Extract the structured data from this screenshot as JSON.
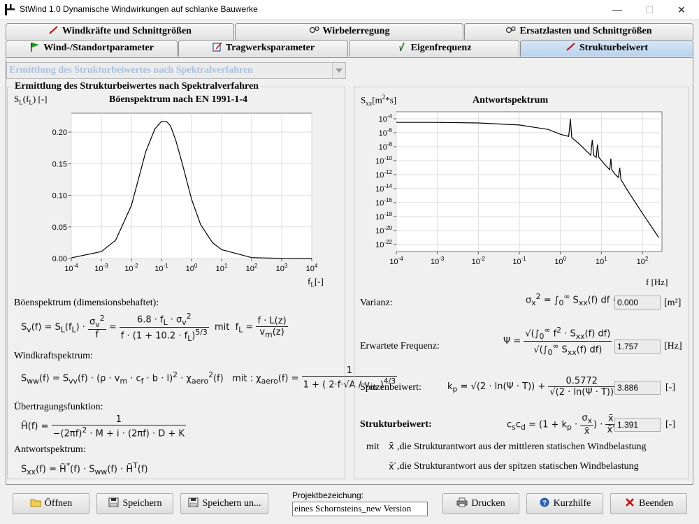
{
  "window": {
    "title": "StWind 1.0    Dynamische Windwirkungen auf schlanke Bauwerke",
    "minimize": "—",
    "maximize": "☐",
    "close": "✕"
  },
  "tabs_row1": [
    {
      "label": "Windkräfte und Schnittgrößen",
      "icon": "pen-icon"
    },
    {
      "label": "Wirbelerregung",
      "icon": "vortex-icon"
    },
    {
      "label": "Ersatzlasten und Schnittgrößen",
      "icon": "vortex-icon"
    }
  ],
  "tabs_row2": [
    {
      "label": "Wind-/Standortparameter",
      "icon": "flag-icon"
    },
    {
      "label": "Tragwerksparameter",
      "icon": "notepad-icon"
    },
    {
      "label": "Eigenfrequenz",
      "icon": "pencil-icon"
    },
    {
      "label": "Strukturbeiwert",
      "icon": "pen-icon",
      "active": true
    }
  ],
  "method_select": {
    "value": "Ermittlung des Strukturbeiwertes nach Spektralverfahren"
  },
  "left_group": {
    "title": "Ermittlung des Strukturbeiwertes nach Spektralverfahren",
    "chart_ylabel": "S_L(f_L) [-]",
    "chart_title": "Böenspektrum nach EN 1991-1-4",
    "chart_xlabel": "f_L [-]",
    "boen_label": "Böenspektrum (dimensionsbehaftet):",
    "windkraft_label": "Windkraftspektrum:",
    "uebertragung_label": "Übertragungsfunktion:",
    "antwort_label": "Antwortspektrum:"
  },
  "right_group": {
    "chart_ylabel": "S_xx [m²*s]",
    "chart_title": "Antwortspektrum",
    "chart_xlabel": "f [Hz]",
    "varianz_label": "Varianz:",
    "varianz_value": "0.000",
    "varianz_unit": "[m²]",
    "frequenz_label": "Erwartete Frequenz:",
    "frequenz_value": "1.757",
    "frequenz_unit": "[Hz]",
    "spitzen_label": "Spitzenbeiwert:",
    "spitzen_value": "3.886",
    "spitzen_unit": "[-]",
    "struktur_label": "Strukturbeiwert:",
    "struktur_value": "1.391",
    "struktur_unit": "[-]",
    "mit": "mit",
    "note1": ",die Strukturantwort aus der mittleren statischen Windbelastung",
    "note2": ",die Strukturantwort aus der spitzen statischen Windbelastung"
  },
  "buttons": {
    "open": "Öffnen",
    "save": "Speichern",
    "save_as": "Speichern un...",
    "print": "Drucken",
    "help": "Kurzhilfe",
    "exit": "Beenden"
  },
  "project": {
    "label": "Projektbezeichung:",
    "value": "eines Schornsteins_new Version"
  },
  "chart_data": [
    {
      "type": "line",
      "title": "Böenspektrum nach EN 1991-1-4",
      "xlabel": "f_L [-]",
      "ylabel": "S_L(f_L) [-]",
      "xscale": "log",
      "xlim": [
        0.0001,
        10000
      ],
      "ylim": [
        0,
        0.23
      ],
      "xticks": [
        "10-4",
        "10-3",
        "10-2",
        "10-1",
        "100",
        "101",
        "102",
        "103",
        "104"
      ],
      "yticks": [
        "0.00",
        "0.05",
        "0.10",
        "0.15",
        "0.20"
      ],
      "grid": true,
      "series": [
        {
          "x": [
            0.0001,
            0.001,
            0.003,
            0.01,
            0.03,
            0.06,
            0.1,
            0.146,
            0.2,
            0.3,
            0.5,
            1,
            2,
            5,
            10,
            100,
            1000,
            10000
          ],
          "y": [
            0.001,
            0.011,
            0.029,
            0.084,
            0.169,
            0.205,
            0.217,
            0.217,
            0.21,
            0.187,
            0.149,
            0.094,
            0.054,
            0.025,
            0.014,
            0.0014,
            0.0001,
            1e-05
          ]
        }
      ]
    },
    {
      "type": "line",
      "title": "Antwortspektrum",
      "xlabel": "f [Hz]",
      "ylabel": "S_xx [m²*s]",
      "xscale": "log",
      "yscale": "log",
      "xlim": [
        0.0001,
        300
      ],
      "ylim": [
        1e-23,
        0.001
      ],
      "xticks": [
        "10-4",
        "10-3",
        "10-2",
        "10-1",
        "100",
        "101",
        "102"
      ],
      "yticks": [
        "10-4",
        "10-6",
        "10-8",
        "10-10",
        "10-12",
        "10-14",
        "10-16",
        "10-18",
        "10-20",
        "10-22"
      ],
      "grid": true,
      "series": [
        {
          "x": [
            0.0001,
            0.001,
            0.01,
            0.1,
            0.5,
            1,
            1.6,
            1.757,
            1.9,
            3,
            5.5,
            6,
            6.5,
            7.5,
            8,
            8.7,
            12,
            16,
            17,
            18,
            22,
            26,
            28,
            30,
            45,
            100,
            250
          ],
          "y": [
            3e-05,
            3e-05,
            2.5e-05,
            1.3e-05,
            3e-06,
            6e-07,
            3e-07,
            0.0001,
            2e-07,
            2e-08,
            6e-10,
            1e-07,
            6e-10,
            3e-10,
            2e-08,
            3e-10,
            3e-11,
            5e-12,
            2e-10,
            5e-12,
            1e-12,
            4e-13,
            1e-11,
            2e-13,
            4e-15,
            3e-18,
            1e-21
          ]
        }
      ]
    }
  ]
}
